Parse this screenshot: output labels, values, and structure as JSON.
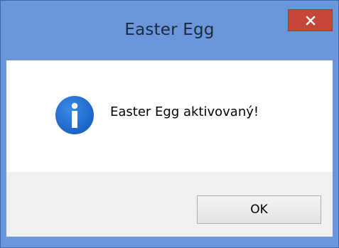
{
  "window": {
    "title": "Easter Egg",
    "close_icon": "close-x-icon",
    "titlebar_color": "#6b96db",
    "close_button_color": "#c7463a"
  },
  "dialog": {
    "icon": "info-icon",
    "icon_color": "#1f6fd1",
    "message": "Easter Egg aktivovaný!"
  },
  "buttons": {
    "ok_label": "OK"
  }
}
